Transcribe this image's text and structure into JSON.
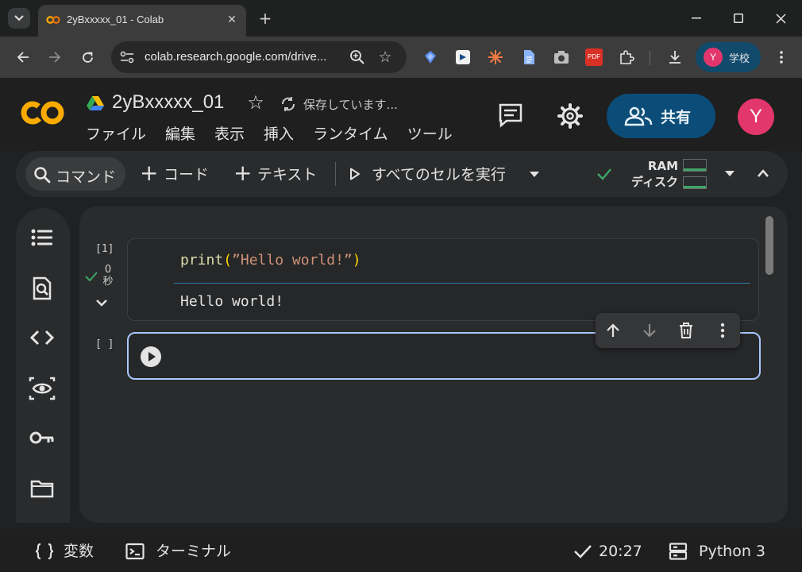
{
  "browser": {
    "tab_title": "2yBxxxxx_01 - Colab",
    "url": "colab.research.google.com/drive...",
    "profile_label": "学校",
    "profile_initial": "Y",
    "extension_pdf_label": "PDF"
  },
  "notebook": {
    "title": "2yBxxxxx_01",
    "save_status": "保存しています...",
    "share_label": "共有",
    "user_initial": "Y",
    "menu": [
      "ファイル",
      "編集",
      "表示",
      "挿入",
      "ランタイム",
      "ツール"
    ]
  },
  "toolbar": {
    "command_label": "コマンド",
    "add_code_label": "コード",
    "add_text_label": "テキスト",
    "run_all_label": "すべてのセルを実行",
    "ram_label": "RAM",
    "disk_label": "ディスク"
  },
  "cells": [
    {
      "exec_count": "[1]",
      "run_time_value": "0",
      "run_time_unit": "秒",
      "code_fn": "print",
      "code_open": "(",
      "code_str": "”Hello world!”",
      "code_close": ")",
      "output": "Hello world!"
    },
    {
      "exec_count": "[ ]"
    }
  ],
  "statusbar": {
    "variables_label": "変数",
    "terminal_label": "ターミナル",
    "time": "20:27",
    "runtime_label": "Python 3"
  },
  "colors": {
    "accent": "#a8c7fa",
    "share_bg": "#0b4d78",
    "avatar": "#e2366d",
    "success": "#3fa567"
  }
}
